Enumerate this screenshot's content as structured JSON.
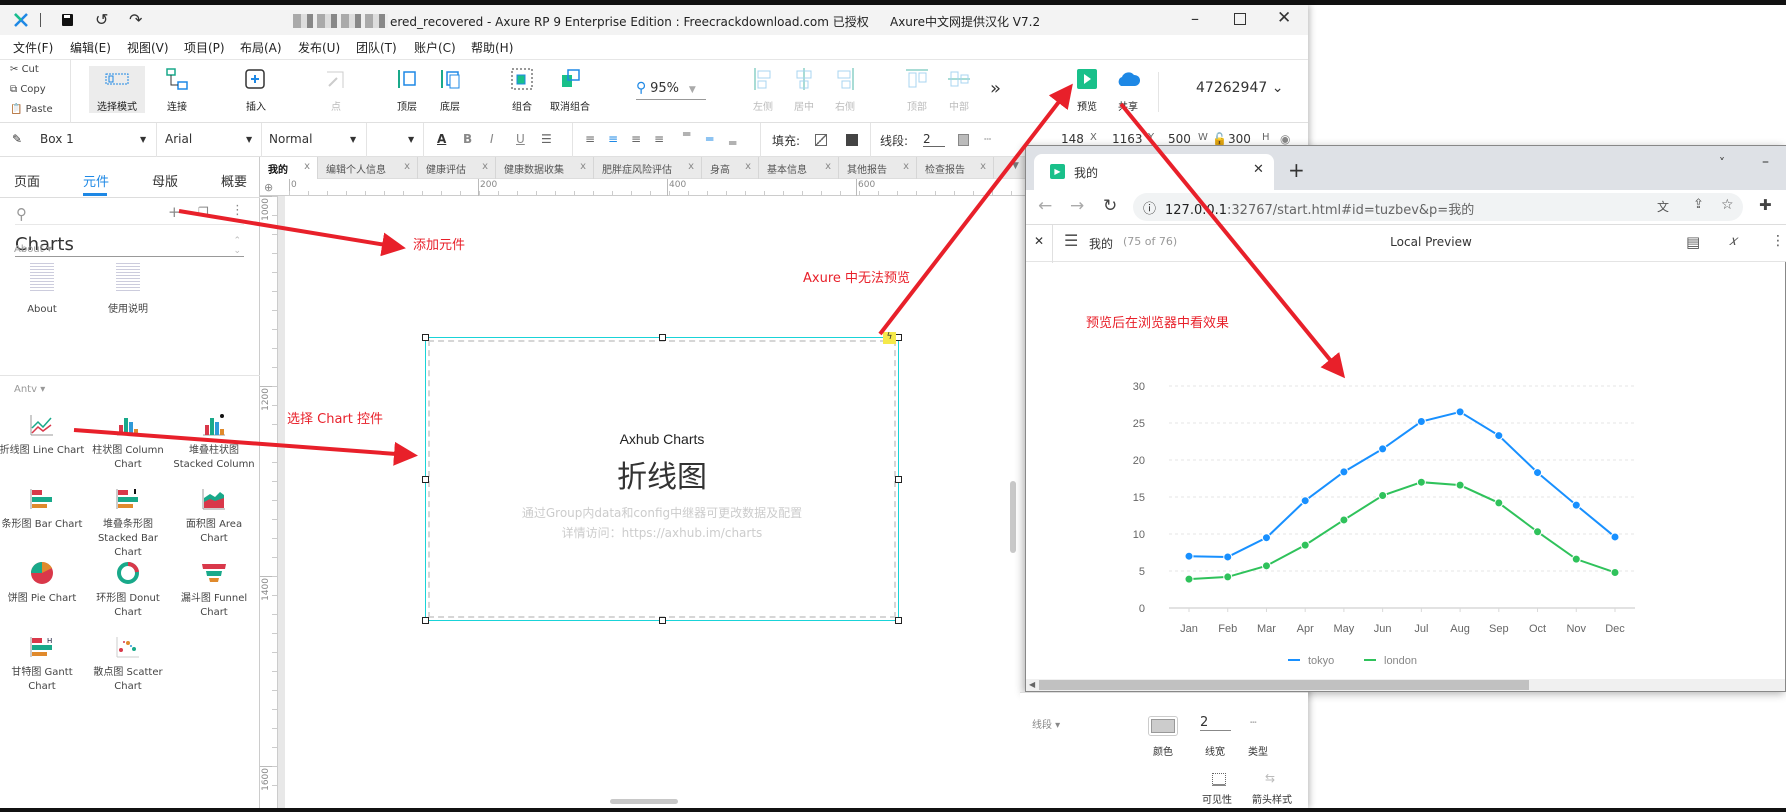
{
  "window": {
    "title": "ered_recovered - Axure RP 9 Enterprise Edition : Freecrackdownload.com 已授权",
    "title_right": "Axure中文网提供汉化 V7.2"
  },
  "menu": [
    "文件(F)",
    "编辑(E)",
    "视图(V)",
    "项目(P)",
    "布局(A)",
    "发布(U)",
    "团队(T)",
    "账户(C)",
    "帮助(H)"
  ],
  "clipboard": {
    "cut": "Cut",
    "copy": "Copy",
    "paste": "Paste"
  },
  "toolbar": [
    {
      "label": "选择模式",
      "icon": "select-mode-icon",
      "disabled": false
    },
    {
      "label": "连接",
      "icon": "connect-icon",
      "disabled": false
    },
    {
      "label": "插入",
      "icon": "insert-icon",
      "disabled": false
    },
    {
      "label": "点",
      "icon": "point-icon",
      "disabled": true
    },
    {
      "label": "顶层",
      "icon": "bring-front-icon",
      "disabled": false
    },
    {
      "label": "底层",
      "icon": "send-back-icon",
      "disabled": false
    },
    {
      "label": "组合",
      "icon": "group-icon",
      "disabled": false
    },
    {
      "label": "取消组合",
      "icon": "ungroup-icon",
      "disabled": false
    },
    {
      "label": "左侧",
      "icon": "align-left-icon",
      "disabled": true
    },
    {
      "label": "居中",
      "icon": "align-center-icon",
      "disabled": true
    },
    {
      "label": "右侧",
      "icon": "align-right-icon",
      "disabled": true
    },
    {
      "label": "顶部",
      "icon": "align-top-icon",
      "disabled": true
    },
    {
      "label": "中部",
      "icon": "align-middle-icon",
      "disabled": true
    },
    {
      "label": "预览",
      "icon": "preview-icon",
      "disabled": false
    },
    {
      "label": "共享",
      "icon": "share-cloud-icon",
      "disabled": false
    }
  ],
  "zoom": "95%",
  "more": "»",
  "user": "47262947",
  "format": {
    "widget": "Box 1",
    "font": "Arial",
    "style": "Normal",
    "fill_label": "填充:",
    "line_label": "线段:",
    "line_width": "2",
    "x": "148",
    "x_label": "X",
    "y": "1163",
    "y_label": "Y",
    "w": "500",
    "w_label": "W",
    "h": "300",
    "h_label": "H"
  },
  "left_panel": {
    "tabs": [
      "页面",
      "元件",
      "母版",
      "概要"
    ],
    "library": "Charts",
    "groups": [
      {
        "name": "About ▾",
        "items": [
          "About",
          "使用说明"
        ]
      },
      {
        "name": "Antv ▾",
        "items": [
          "折线图 Line Chart",
          "柱状图 Column Chart",
          "堆叠柱状图 Stacked Column",
          "条形图 Bar Chart",
          "堆叠条形图 Stacked Bar Chart",
          "面积图 Area Chart",
          "饼图 Pie Chart",
          "环形图 Donut Chart",
          "漏斗图 Funnel Chart",
          "甘特图 Gantt Chart",
          "散点图 Scatter Chart"
        ]
      }
    ]
  },
  "doc_tabs": [
    "我的",
    "编辑个人信息",
    "健康评估",
    "健康数据收集",
    "肥胖症风险评估",
    "身高",
    "基本信息",
    "其他报告",
    "检查报告"
  ],
  "hruler": [
    "0",
    "200",
    "400",
    "600"
  ],
  "vruler": [
    "1000",
    "1200",
    "1400",
    "1600"
  ],
  "widget": {
    "subtitle": "Axhub Charts",
    "title": "折线图",
    "hint1": "通过Group内data和config中继器可更改数据及配置",
    "hint2": "详情访问：https://axhub.im/charts"
  },
  "annotations": {
    "add": "添加元件",
    "select": "选择 Chart 控件",
    "no_preview": "Axure 中无法预览",
    "browser": "预览后在浏览器中看效果"
  },
  "browser": {
    "tab_title": "我的",
    "url_host": "127.0.0.1",
    "url_rest": ":32767/start.html#id=tuzbev&p=我的",
    "page": "我的",
    "page_count": "(75 of 76)",
    "header_title": "Local Preview"
  },
  "props": {
    "section": "线段 ▾",
    "color_label": "颜色",
    "width": "2",
    "width_label": "线宽",
    "type_label": "类型",
    "visibility_label": "可见性",
    "arrow_label": "箭头样式"
  },
  "colors": {
    "accent": "#1e88e5",
    "annotation": "#e8202a",
    "tokyo": "#1890ff",
    "london": "#2fc25b",
    "preview": "#19c08a"
  },
  "chart_data": {
    "type": "line",
    "categories": [
      "Jan",
      "Feb",
      "Mar",
      "Apr",
      "May",
      "Jun",
      "Jul",
      "Aug",
      "Sep",
      "Oct",
      "Nov",
      "Dec"
    ],
    "series": [
      {
        "name": "tokyo",
        "values": [
          7,
          6.9,
          9.5,
          14.5,
          18.4,
          21.5,
          25.2,
          26.5,
          23.3,
          18.3,
          13.9,
          9.6
        ]
      },
      {
        "name": "london",
        "values": [
          3.9,
          4.2,
          5.7,
          8.5,
          11.9,
          15.2,
          17,
          16.6,
          14.2,
          10.3,
          6.6,
          4.8
        ]
      }
    ],
    "yticks": [
      "0",
      "5",
      "10",
      "15",
      "20",
      "25",
      "30"
    ],
    "ylim": [
      0,
      30
    ],
    "grid": true,
    "legend": "bottom",
    "title": "",
    "xlabel": "",
    "ylabel": ""
  }
}
